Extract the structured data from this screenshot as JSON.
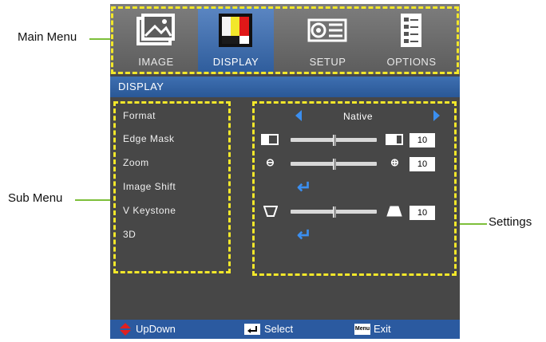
{
  "callouts": {
    "main_menu": "Main Menu",
    "sub_menu": "Sub Menu",
    "settings": "Settings"
  },
  "tabs": [
    {
      "label": "IMAGE",
      "icon": "image-icon"
    },
    {
      "label": "DISPLAY",
      "icon": "display-icon"
    },
    {
      "label": "SETUP",
      "icon": "projector-icon"
    },
    {
      "label": "OPTIONS",
      "icon": "options-icon"
    }
  ],
  "title": "DISPLAY",
  "sub_menu": [
    "Format",
    "Edge Mask",
    "Zoom",
    "Image Shift",
    "V Keystone",
    "3D"
  ],
  "settings": {
    "format": "Native",
    "edge_mask": "10",
    "zoom": "10",
    "v_keystone": "10"
  },
  "bottom": {
    "updown": "UpDown",
    "select": "Select",
    "menu_key": "Menu",
    "exit": "Exit"
  },
  "colors": {
    "accent": "#2b5aa0",
    "highlight": "#f2e72a",
    "callout": "#7dbf3a",
    "enter": "#3b8ff0"
  }
}
